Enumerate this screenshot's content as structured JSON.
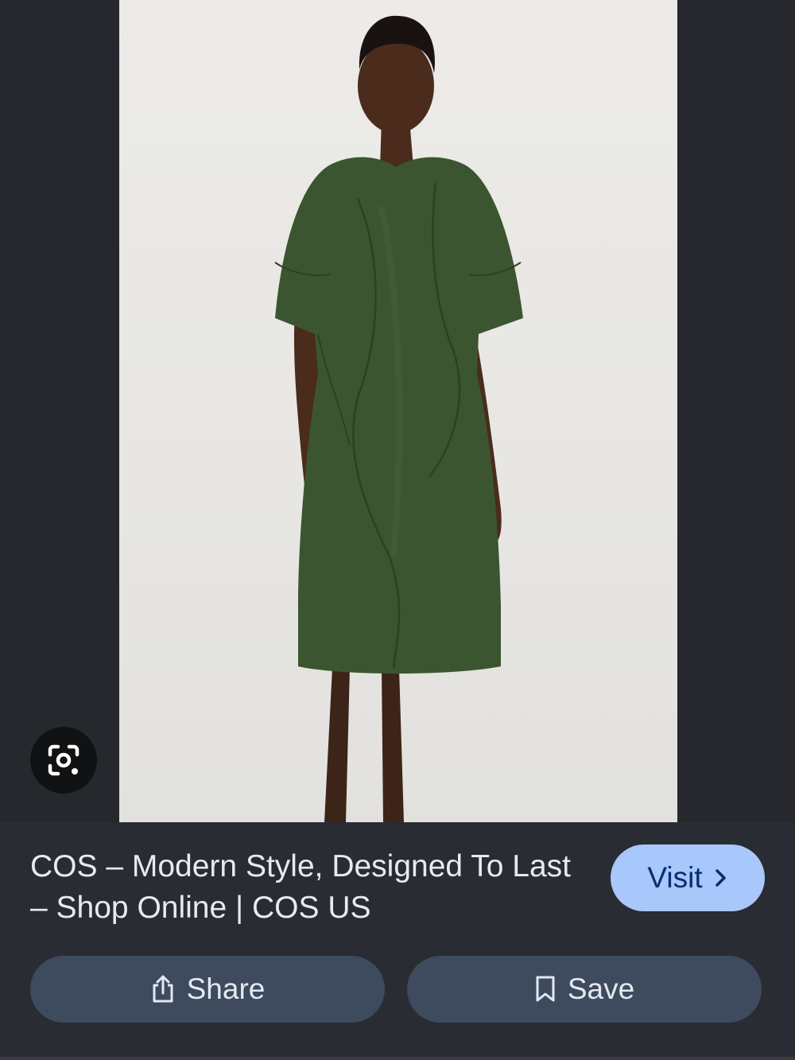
{
  "result": {
    "title": "COS – Modern Style, Designed To Last – Shop Online | COS US"
  },
  "actions": {
    "visit_label": "Visit",
    "share_label": "Share",
    "save_label": "Save"
  },
  "icons": {
    "lens": "google-lens-icon",
    "visit_chevron": "chevron-right-icon",
    "share": "share-icon",
    "save": "bookmark-icon"
  },
  "colors": {
    "page_background": "#26282e",
    "panel_background": "#2a2c33",
    "visit_button": "#a8c7fa",
    "action_button": "#3e4a5d",
    "dress_green": "#3b5530"
  }
}
